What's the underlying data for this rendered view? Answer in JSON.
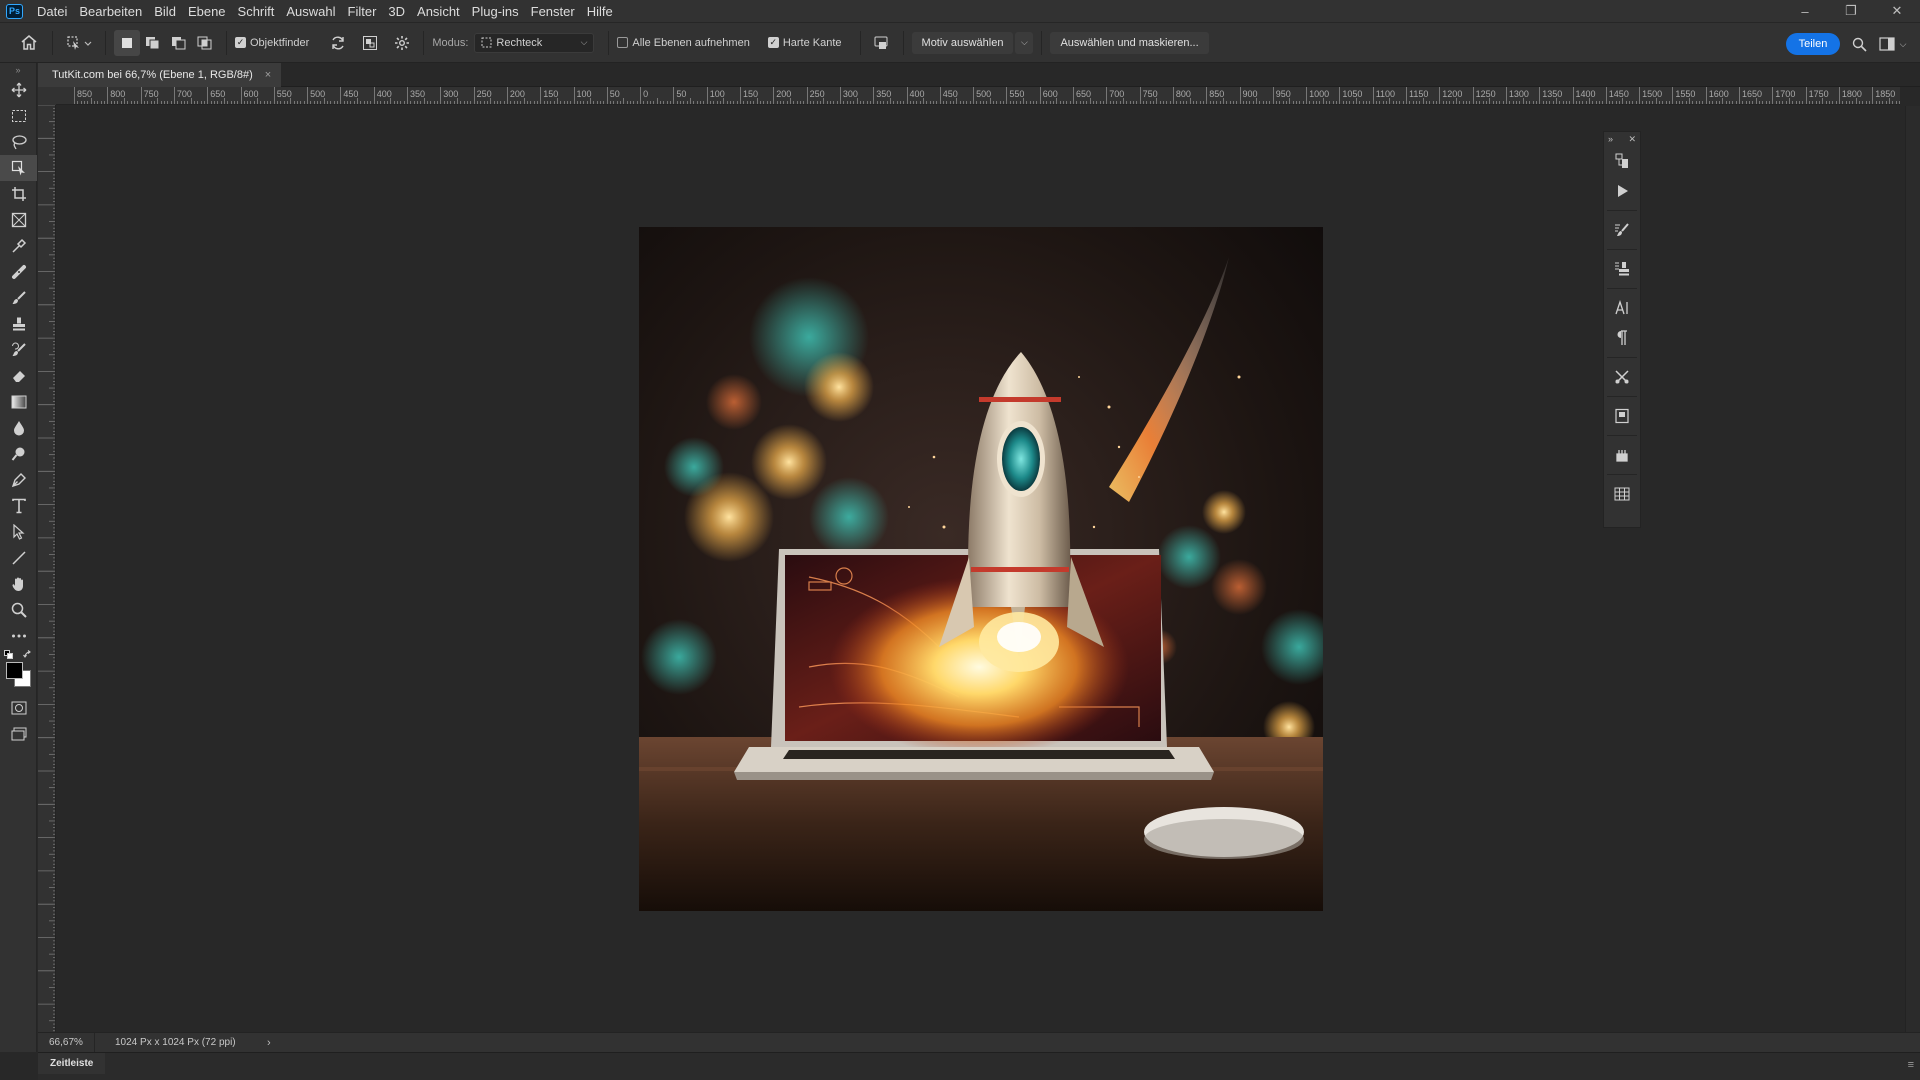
{
  "app": {
    "logo": "Ps"
  },
  "menubar": {
    "items": [
      "Datei",
      "Bearbeiten",
      "Bild",
      "Ebene",
      "Schrift",
      "Auswahl",
      "Filter",
      "3D",
      "Ansicht",
      "Plug-ins",
      "Fenster",
      "Hilfe"
    ]
  },
  "window_controls": {
    "minimize": "–",
    "restore": "❐",
    "close": "✕"
  },
  "options": {
    "object_finder_label": "Objektfinder",
    "object_finder_checked": true,
    "mode_label": "Modus:",
    "mode_value": "Rechteck",
    "all_layers_label": "Alle Ebenen aufnehmen",
    "all_layers_checked": false,
    "hard_edge_label": "Harte Kante",
    "hard_edge_checked": true,
    "select_subject_label": "Motiv auswählen",
    "select_mask_label": "Auswählen und maskieren...",
    "share_label": "Teilen"
  },
  "document": {
    "tab_title": "TutKit.com bei 66,7% (Ebene 1, RGB/8#)",
    "tab_close": "×"
  },
  "ruler": {
    "labels": [
      "850",
      "800",
      "750",
      "700",
      "650",
      "600",
      "550",
      "500",
      "450",
      "400",
      "350",
      "300",
      "250",
      "200",
      "150",
      "100",
      "50",
      "0",
      "50",
      "100",
      "150",
      "200",
      "250",
      "300",
      "350",
      "400",
      "450",
      "500",
      "550",
      "600",
      "650",
      "700",
      "750",
      "800",
      "850",
      "900",
      "950",
      "1000",
      "1050",
      "1100",
      "1150",
      "1200",
      "1250",
      "1300",
      "1350",
      "1400",
      "1450",
      "1500",
      "1550",
      "1600",
      "1650",
      "1700",
      "1750",
      "1800",
      "1850"
    ]
  },
  "status": {
    "zoom": "66,67%",
    "doc_info": "1024 Px x 1024 Px (72 ppi)",
    "arrow": "›"
  },
  "timeline": {
    "tab_label": "Zeitleiste"
  },
  "colors": {
    "accent": "#1473e6",
    "foreground": "#000000",
    "background": "#ffffff"
  },
  "tools": [
    "move-tool",
    "marquee-tool",
    "lasso-tool",
    "object-selection-tool",
    "crop-tool",
    "frame-tool",
    "eyedropper-tool",
    "healing-brush-tool",
    "brush-tool",
    "clone-stamp-tool",
    "history-brush-tool",
    "eraser-tool",
    "gradient-tool",
    "blur-tool",
    "dodge-tool",
    "pen-tool",
    "type-tool",
    "path-selection-tool",
    "line-tool",
    "hand-tool",
    "zoom-tool",
    "more-tools"
  ]
}
